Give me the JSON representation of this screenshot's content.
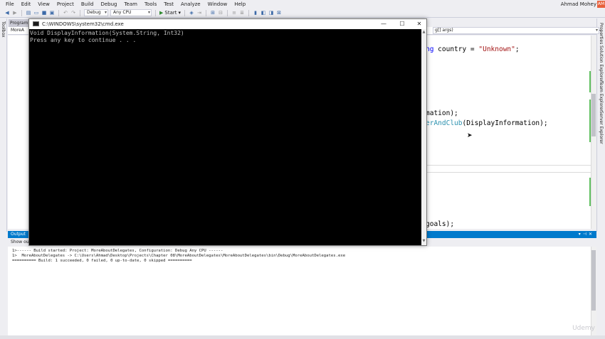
{
  "menu": [
    "File",
    "Edit",
    "View",
    "Project",
    "Build",
    "Debug",
    "Team",
    "Tools",
    "Test",
    "Analyze",
    "Window",
    "Help"
  ],
  "user": {
    "name": "Ahmad Mohey",
    "initials": "AM"
  },
  "toolbar": {
    "config": "Debug",
    "platform": "Any CPU",
    "start_label": "Start"
  },
  "left_strip": {
    "label": "Toolbox"
  },
  "right_strip": {
    "labels": [
      "Properties",
      "Solution Explorer",
      "Team Explorer",
      "Server Explorer"
    ]
  },
  "editor": {
    "tab_label": "Program.cs",
    "nav_left": "MoreA",
    "nav_right": "g[] args)",
    "lines": {
      "l1_kw": "ng",
      "l1_rest": " country = ",
      "l1_str": "\"Unknown\"",
      "l1_end": ";",
      "l2": "mation);",
      "l3_method": "erAndClub",
      "l3_rest": "(DisplayInformation);",
      "l4": "goals);"
    }
  },
  "output": {
    "title": "Output",
    "show_from": "Show ou",
    "lines": [
      "1>------ Build started: Project: MoreAboutDelegates, Configuration: Debug Any CPU ------",
      "1>  MoreAboutDelegates -> C:\\Users\\Ahmad\\Desktop\\Projects\\Chapter 08\\MoreAboutDelegates\\MoreAboutDelegates\\bin\\Debug\\MoreAboutDelegates.exe",
      "========== Build: 1 succeeded, 0 failed, 0 up-to-date, 0 skipped =========="
    ]
  },
  "cmd": {
    "title": "C:\\WINDOWS\\system32\\cmd.exe",
    "lines": [
      "Void DisplayInformation(System.String, Int32)",
      "Press any key to continue . . ."
    ]
  },
  "watermark": "Udemy",
  "colors": {
    "accent": "#007acc",
    "keyword": "#0000ff",
    "type": "#2b91af",
    "string": "#a31515"
  }
}
